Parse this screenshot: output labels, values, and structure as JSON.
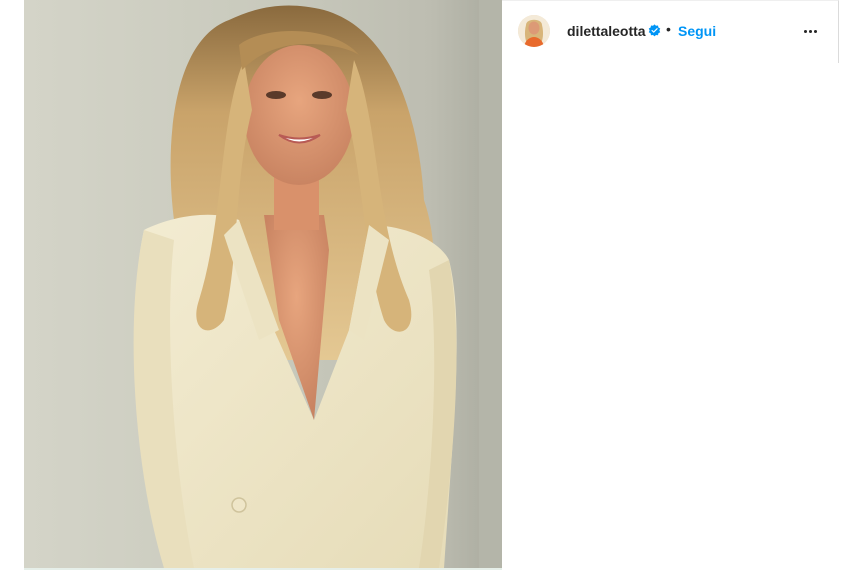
{
  "post": {
    "image_alt": "Woman with long wavy blonde hair wearing a cream blazer, smiling, against a light grey wall",
    "author": {
      "username": "dilettaleotta",
      "verified": true,
      "avatar_icon": "profile-avatar"
    },
    "separator": "•",
    "follow_label": "Segui",
    "more_icon": "more-options-icon"
  },
  "colors": {
    "follow_blue": "#0095f6",
    "verified_blue": "#0095f6",
    "text_dark": "#262626",
    "border": "#dbdbdb"
  }
}
